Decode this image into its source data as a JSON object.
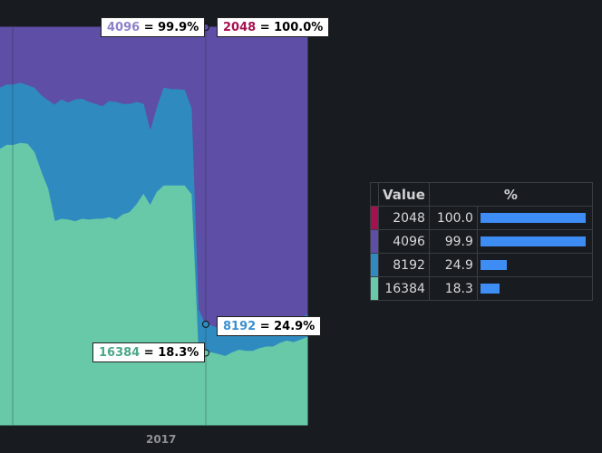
{
  "chart_data": {
    "type": "area",
    "stacked": "percent",
    "x_tick_labels": [
      "2017"
    ],
    "series": [
      {
        "name": "16384",
        "color": "#68c9a8",
        "values": [
          69.3,
          70.3,
          70.3,
          70.8,
          70.6,
          68.5,
          63.6,
          59.3,
          51.1,
          51.7,
          51.5,
          51.1,
          51.7,
          51.5,
          51.7,
          51.7,
          52.1,
          51.5,
          52.8,
          53.4,
          55.3,
          57.9,
          55.1,
          58.5,
          60.1,
          60.1,
          60.1,
          60.1,
          57.9,
          18.8,
          18.1,
          18.1,
          17.7,
          17.2,
          18.1,
          18.8,
          18.5,
          18.5,
          19.2,
          19.6,
          19.6,
          20.5,
          21.1,
          20.7,
          21.3,
          22.0
        ]
      },
      {
        "name": "8192",
        "color": "#2f8bbf",
        "values": [
          84.7,
          85.5,
          85.5,
          85.9,
          85.3,
          84.7,
          82.8,
          81.5,
          80.4,
          81.7,
          80.9,
          81.7,
          81.9,
          81.1,
          80.6,
          80.0,
          81.3,
          81.1,
          80.6,
          80.6,
          81.1,
          80.6,
          73.6,
          79.6,
          84.7,
          84.3,
          84.3,
          84.1,
          79.6,
          29.1,
          25.3,
          24.9,
          24.2,
          24.4,
          24.4,
          24.4,
          24.9,
          24.7,
          24.2,
          24.0,
          24.9,
          24.2,
          25.1,
          26.0,
          26.8,
          27.7
        ]
      },
      {
        "name": "4096",
        "color": "#5e4ea5",
        "values": [
          100,
          100,
          100,
          100,
          100,
          100,
          100,
          100,
          100,
          100,
          100,
          100,
          100,
          100,
          100,
          100,
          100,
          100,
          100,
          100,
          100,
          100,
          100,
          100,
          100,
          100,
          100,
          100,
          100,
          100,
          100,
          100,
          100,
          100,
          100,
          100,
          100,
          100,
          100,
          100,
          100,
          100,
          100,
          100,
          100,
          100
        ]
      },
      {
        "name": "2048",
        "color": "#a41150",
        "values": [
          100,
          100,
          100,
          100,
          100,
          100,
          100,
          100,
          100,
          100,
          100,
          100,
          100,
          100,
          100,
          100,
          100,
          100,
          100,
          100,
          100,
          100,
          100,
          100,
          100,
          100,
          100,
          100,
          100,
          100,
          100,
          100,
          100,
          100,
          100,
          100,
          100,
          100,
          100,
          100,
          100,
          100,
          100,
          100,
          100,
          100
        ]
      }
    ],
    "tooltips": [
      {
        "name": "4096",
        "value": "99.9%",
        "color": "#8d82c9"
      },
      {
        "name": "2048",
        "value": "100.0%",
        "color": "#a41150"
      },
      {
        "name": "8192",
        "value": "24.9%",
        "color": "#3b8fd0"
      },
      {
        "name": "16384",
        "value": "18.3%",
        "color": "#4aa889"
      }
    ],
    "legend": {
      "headers": [
        "Value",
        "%"
      ],
      "rows": [
        {
          "name": "2048",
          "value": "100.0",
          "fraction": 1.0,
          "color": "#a41150"
        },
        {
          "name": "4096",
          "value": "99.9",
          "fraction": 0.999,
          "color": "#5e4ea5"
        },
        {
          "name": "8192",
          "value": "24.9",
          "fraction": 0.249,
          "color": "#2f8bbf"
        },
        {
          "name": "16384",
          "value": "18.3",
          "fraction": 0.183,
          "color": "#68c9a8"
        }
      ]
    },
    "ylim": [
      0,
      100
    ]
  }
}
